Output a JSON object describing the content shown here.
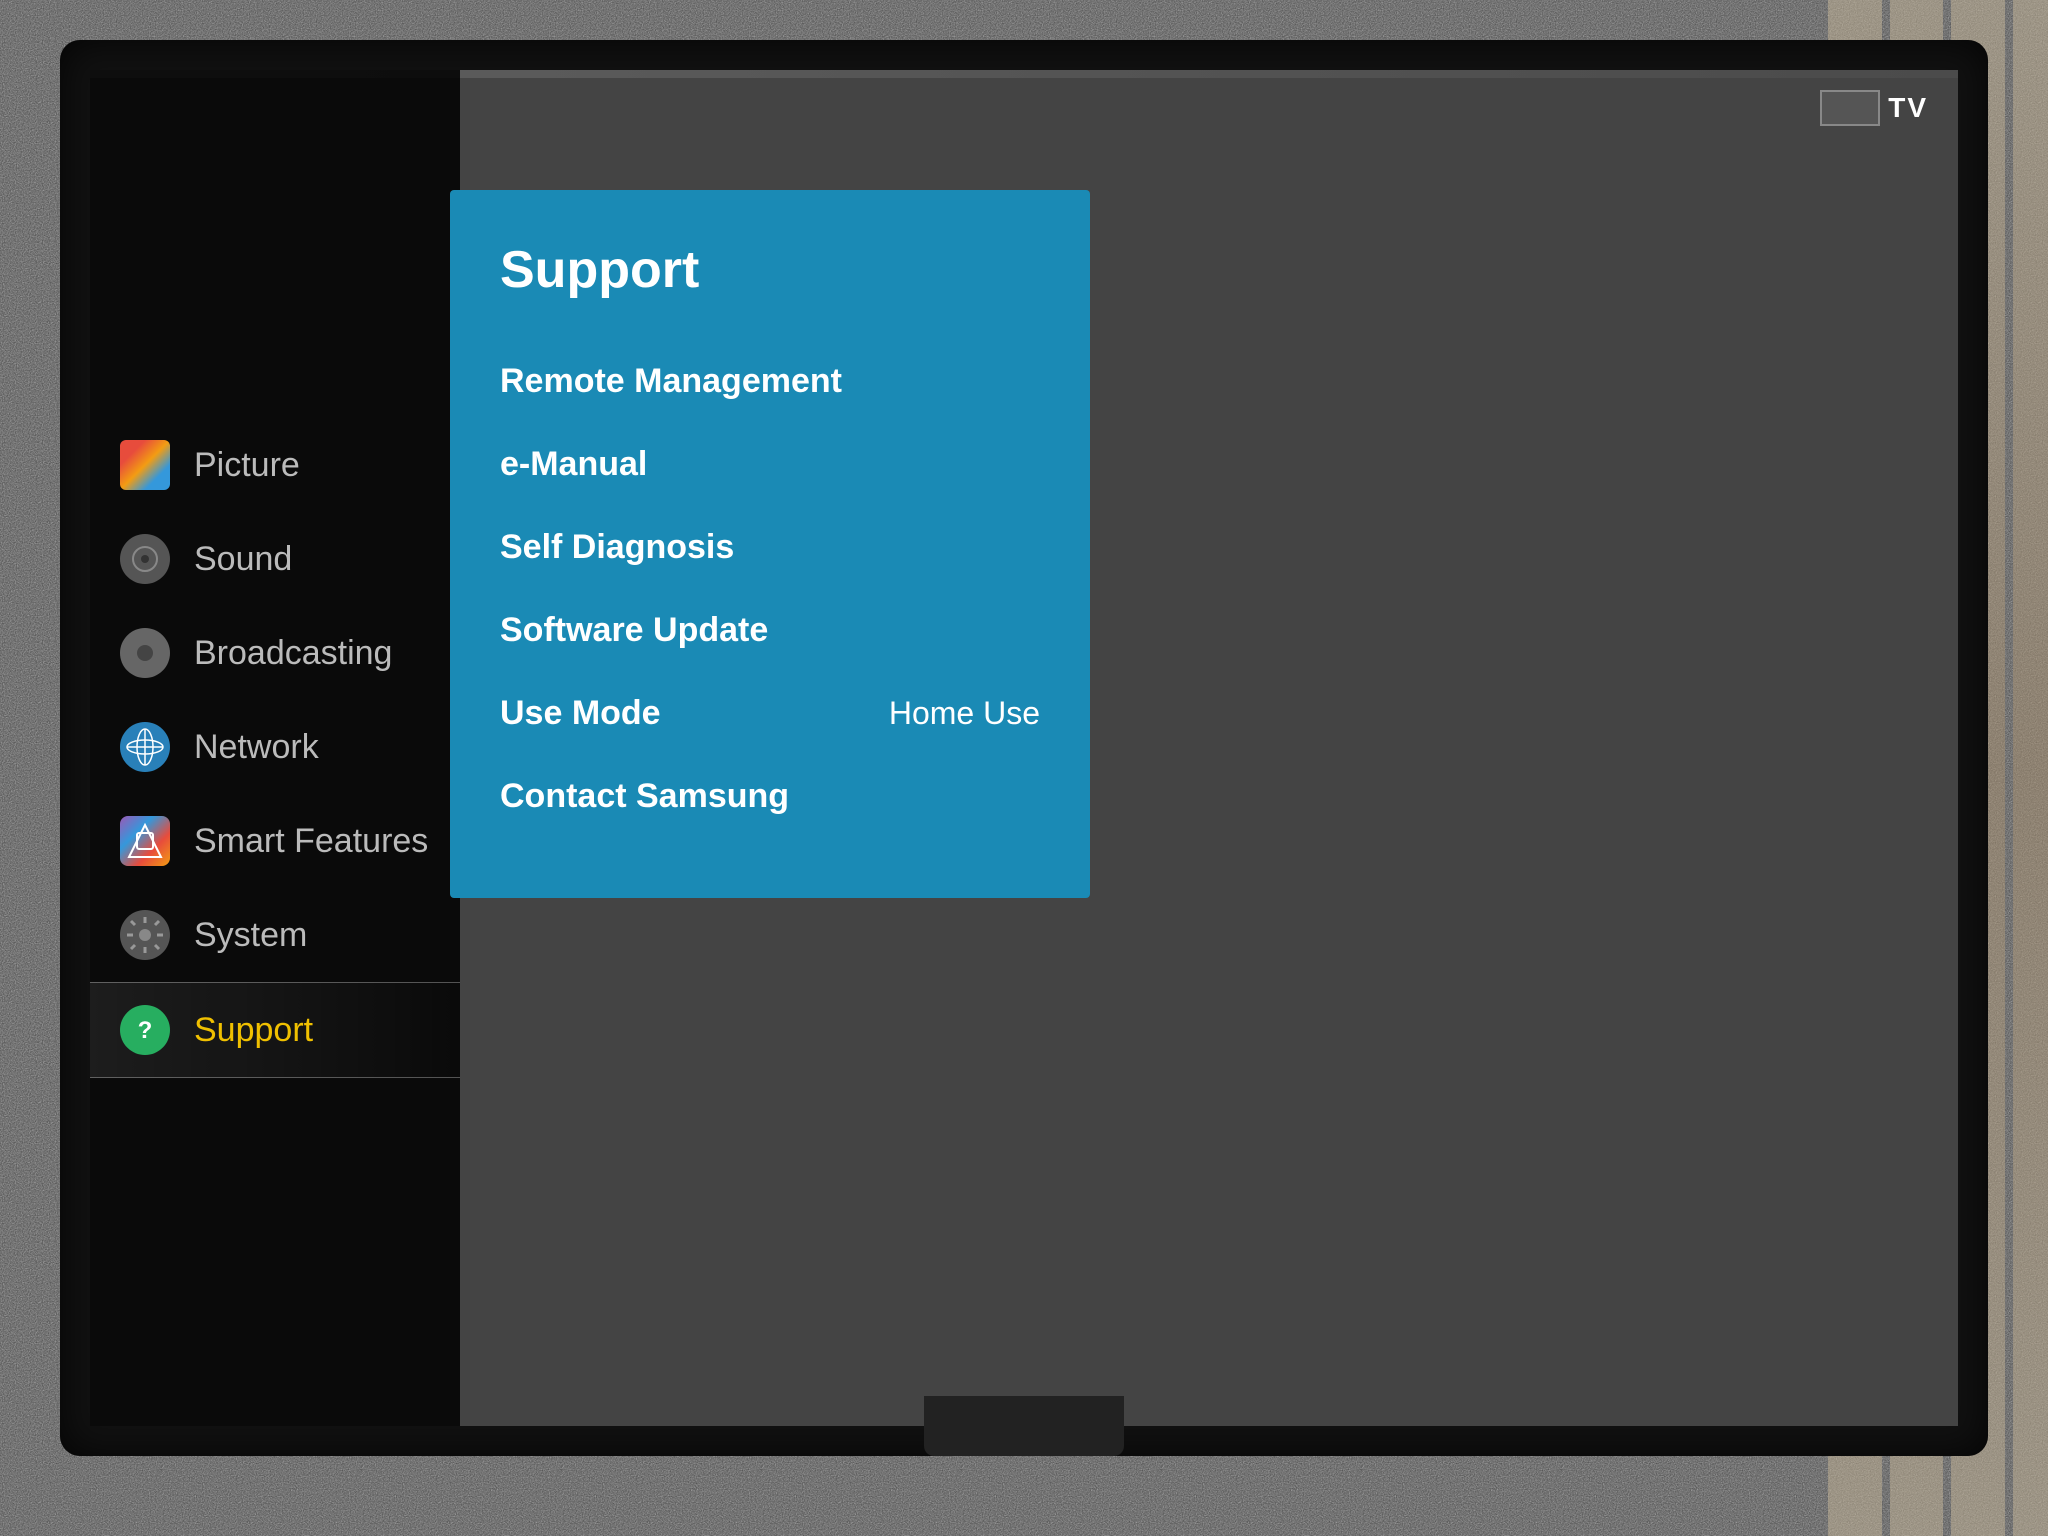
{
  "tv": {
    "label": "TV"
  },
  "sidebar": {
    "items": [
      {
        "id": "picture",
        "label": "Picture",
        "icon": "🖼",
        "active": false
      },
      {
        "id": "sound",
        "label": "Sound",
        "icon": "🔊",
        "active": false
      },
      {
        "id": "broadcasting",
        "label": "Broadcasting",
        "icon": "●",
        "active": false
      },
      {
        "id": "network",
        "label": "Network",
        "icon": "🌐",
        "active": false
      },
      {
        "id": "smart-features",
        "label": "Smart Features",
        "icon": "◈",
        "active": false
      },
      {
        "id": "system",
        "label": "System",
        "icon": "⚙",
        "active": false
      },
      {
        "id": "support",
        "label": "Support",
        "icon": "?",
        "active": true
      }
    ]
  },
  "support_panel": {
    "title": "Support",
    "items": [
      {
        "id": "remote-management",
        "label": "Remote Management",
        "value": ""
      },
      {
        "id": "e-manual",
        "label": "e-Manual",
        "value": ""
      },
      {
        "id": "self-diagnosis",
        "label": "Self Diagnosis",
        "value": ""
      },
      {
        "id": "software-update",
        "label": "Software Update",
        "value": ""
      },
      {
        "id": "use-mode",
        "label": "Use Mode",
        "value": "Home Use"
      },
      {
        "id": "contact-samsung",
        "label": "Contact Samsung",
        "value": ""
      }
    ]
  }
}
